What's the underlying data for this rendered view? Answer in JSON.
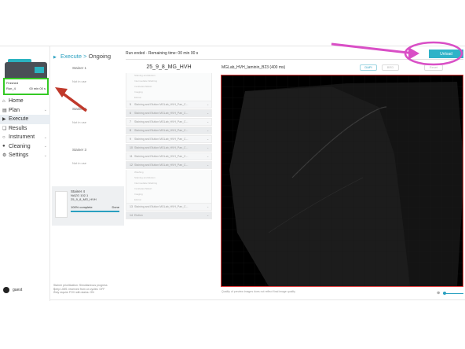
{
  "device": {
    "status": "Finished",
    "run": "Run_4",
    "time": "00 min 00 s"
  },
  "nav": [
    {
      "label": "Home",
      "icon": "home-icon"
    },
    {
      "label": "Plan",
      "icon": "plan-icon"
    },
    {
      "label": "Execute",
      "icon": "play-icon"
    },
    {
      "label": "Results",
      "icon": "results-icon"
    },
    {
      "label": "Instrument",
      "icon": "instrument-icon"
    },
    {
      "label": "Cleaning",
      "icon": "drop-icon"
    },
    {
      "label": "Settings",
      "icon": "gear-icon"
    }
  ],
  "user": {
    "name": "guest"
  },
  "breadcrumb": {
    "parent": "Execute",
    "sep": ">",
    "current": "Ongoing"
  },
  "stainers": [
    {
      "name": "Stainer 1",
      "sub": "Not in use"
    },
    {
      "name": "Stainer 2",
      "sub": "Not in use"
    },
    {
      "name": "Stainer 3",
      "sub": "Not in use"
    }
  ],
  "stainer4": {
    "name": "Stainer 4",
    "line1": "NAZG 102.1",
    "line2": "25_9_8_MG_HVH",
    "progress_label": "100% complete",
    "progress": 1.0,
    "status": "Done"
  },
  "footer_notes": [
    "Stainer prioritization: Simultaneous progress",
    "Keep LIMS: reserved from on cycles: OFF",
    "Only require FOV with stains: ON"
  ],
  "run_status": "Run ended  ·  Remaining time: 00 min 00 s",
  "unload_label": "Unload",
  "protocol": {
    "title": "25_9_8_MG_HVH",
    "step_label": "Staining and Elution MGLab_HVH_Pan_C...",
    "substep_labels": [
      "Staining and Elution",
      "Intermediate Washing",
      "Incubation/Wash",
      "Imaging",
      "Elution",
      "Washing"
    ],
    "final_label": "Elution"
  },
  "image": {
    "title": "MGLab_HVH_laminin_B23 (400 ms)",
    "buttons": [
      "DAPI",
      "BRD",
      "Reset"
    ],
    "caption": "Quality of preview images does not reflect final image quality"
  },
  "colors": {
    "accent": "#2fb3c8",
    "annotation_pink": "#d94fc6",
    "annotation_red": "#c0392b",
    "highlight_green": "#34c924"
  }
}
